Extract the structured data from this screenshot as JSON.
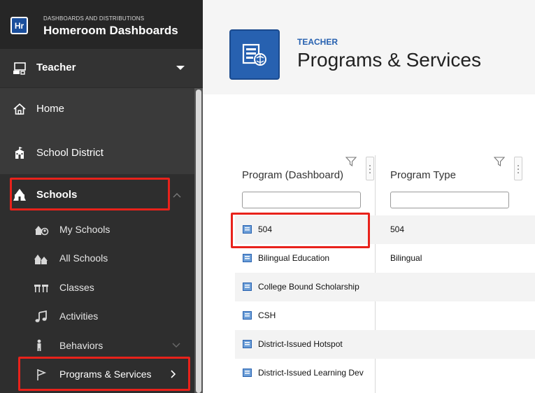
{
  "brand": {
    "logo_text": "Hr",
    "kicker": "DASHBOARDS AND DISTRIBUTIONS",
    "title": "Homeroom Dashboards"
  },
  "role": {
    "label": "Teacher"
  },
  "nav": {
    "home": "Home",
    "school_district": "School District",
    "schools": "Schools",
    "sub_items": [
      {
        "label": "My Schools"
      },
      {
        "label": "All Schools"
      },
      {
        "label": "Classes"
      },
      {
        "label": "Activities"
      },
      {
        "label": "Behaviors"
      },
      {
        "label": "Programs & Services"
      }
    ]
  },
  "header": {
    "kicker": "TEACHER",
    "title": "Programs & Services"
  },
  "grid": {
    "columns": [
      {
        "label": "Program (Dashboard)",
        "filter_value": ""
      },
      {
        "label": "Program Type",
        "filter_value": ""
      }
    ],
    "rows": [
      {
        "program": "504",
        "type": "504"
      },
      {
        "program": "Bilingual Education",
        "type": "Bilingual"
      },
      {
        "program": "College Bound Scholarship",
        "type": ""
      },
      {
        "program": "CSH",
        "type": ""
      },
      {
        "program": "District-Issued Hotspot",
        "type": ""
      },
      {
        "program": "District-Issued Learning Dev",
        "type": ""
      }
    ]
  },
  "colors": {
    "accent_blue": "#2761b0",
    "highlight_red": "#e8221b",
    "sidebar_bg": "#3a3a3a"
  }
}
